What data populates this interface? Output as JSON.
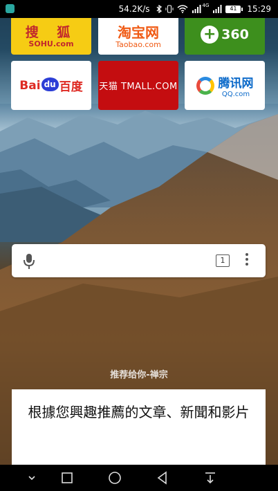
{
  "status_bar": {
    "network_speed": "54.2K/s",
    "signal_type": "4G",
    "battery_level": "41",
    "time": "15:29"
  },
  "speed_dial": [
    {
      "name": "sohu",
      "label_cn": "搜 狐",
      "label_en": "SOHU.com"
    },
    {
      "name": "taobao",
      "label_cn": "淘宝网",
      "label_en": "Taobao.com"
    },
    {
      "name": "360",
      "label": "360"
    },
    {
      "name": "baidu",
      "label_bai": "Bai",
      "label_du": "du",
      "label_cn": "百度"
    },
    {
      "name": "tmall",
      "label": "天猫 TMALL.COM"
    },
    {
      "name": "qq",
      "label_cn": "腾讯网",
      "label_en": "QQ.com"
    }
  ],
  "search_bar": {
    "tab_count": "1"
  },
  "recommendation": {
    "label": "推荐给你-禅宗",
    "card_text": "根據您興趣推薦的文章、新聞和影片"
  },
  "colors": {
    "sohu": "#f6cc14",
    "tmall": "#c40d10",
    "green_360": "#3d8f1d"
  }
}
